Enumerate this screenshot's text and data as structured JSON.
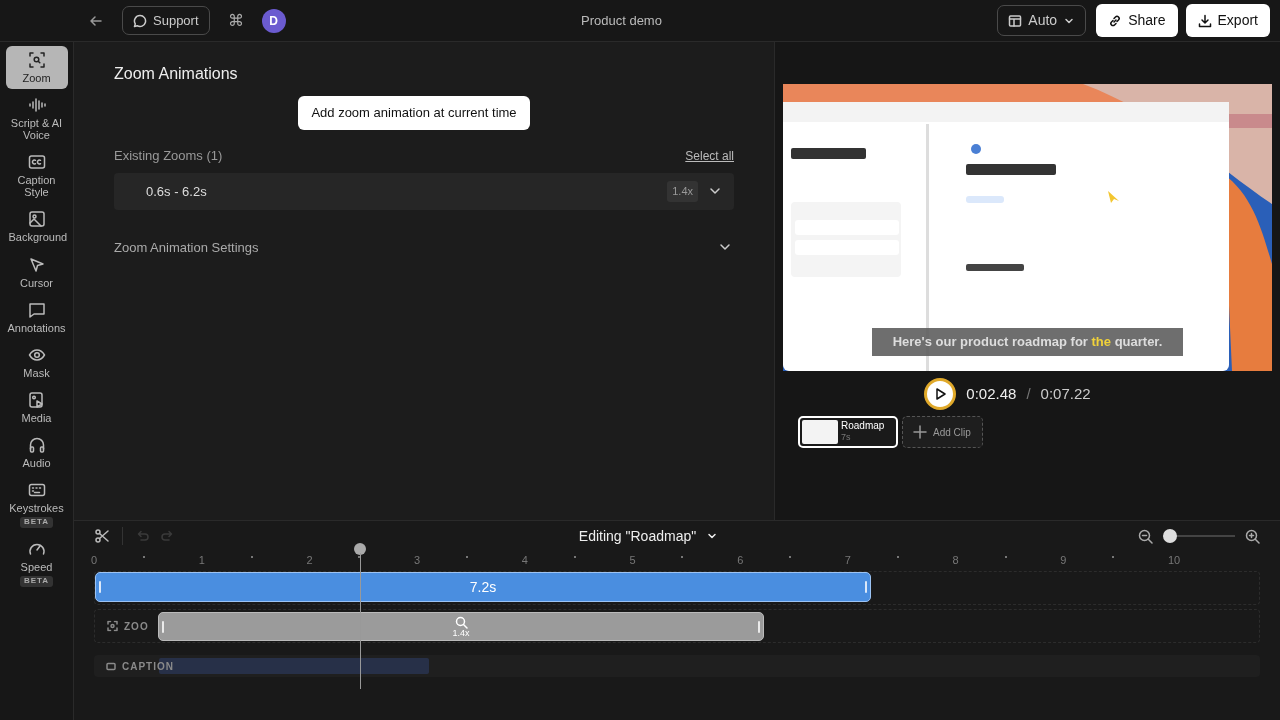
{
  "topbar": {
    "support": "Support",
    "shortcut": "⌘",
    "avatar": "D",
    "title": "Product demo",
    "layout": "Auto",
    "share": "Share",
    "export": "Export"
  },
  "sidebar": {
    "items": [
      {
        "label": "Zoom",
        "selected": true
      },
      {
        "label": "Script & AI Voice",
        "selected": false
      },
      {
        "label": "Caption Style",
        "selected": false
      },
      {
        "label": "Background",
        "selected": false
      },
      {
        "label": "Cursor",
        "selected": false
      },
      {
        "label": "Annotations",
        "selected": false
      },
      {
        "label": "Mask",
        "selected": false
      },
      {
        "label": "Media",
        "selected": false
      },
      {
        "label": "Audio",
        "selected": false
      },
      {
        "label": "Keystrokes",
        "selected": false,
        "badge": "BETA"
      },
      {
        "label": "Speed",
        "selected": false,
        "badge": "BETA"
      }
    ]
  },
  "panel": {
    "title": "Zoom Animations",
    "add_button": "Add zoom animation at current time",
    "existing_label": "Existing Zooms (1)",
    "select_all": "Select all",
    "zooms": [
      {
        "range": "0.6s - 6.2s",
        "factor": "1.4x",
        "expanded": false
      }
    ],
    "settings": {
      "label": "Zoom Animation Settings",
      "expanded": false
    }
  },
  "preview": {
    "kind": "picture",
    "caption": "Here's our product roadmap for **the** quarter.",
    "current_time": "0:02.48",
    "separator": "/",
    "total_time": "0:07.22",
    "clips": [
      {
        "name": "Roadmap",
        "duration": "7s",
        "selected": true
      }
    ],
    "add_clip": "Add Clip"
  },
  "timeline": {
    "editing": "Editing \"Roadmap\"",
    "zoom_slider": {
      "level": 0.1
    },
    "ruler": [
      "0",
      "1",
      "2",
      "3",
      "4",
      "5",
      "6",
      "7",
      "8",
      "9",
      "10"
    ],
    "clip_bar": "7.2s",
    "zoom_track": "ZOO",
    "zoom_bar": "1.4x",
    "caption_track": "CAPTION"
  }
}
